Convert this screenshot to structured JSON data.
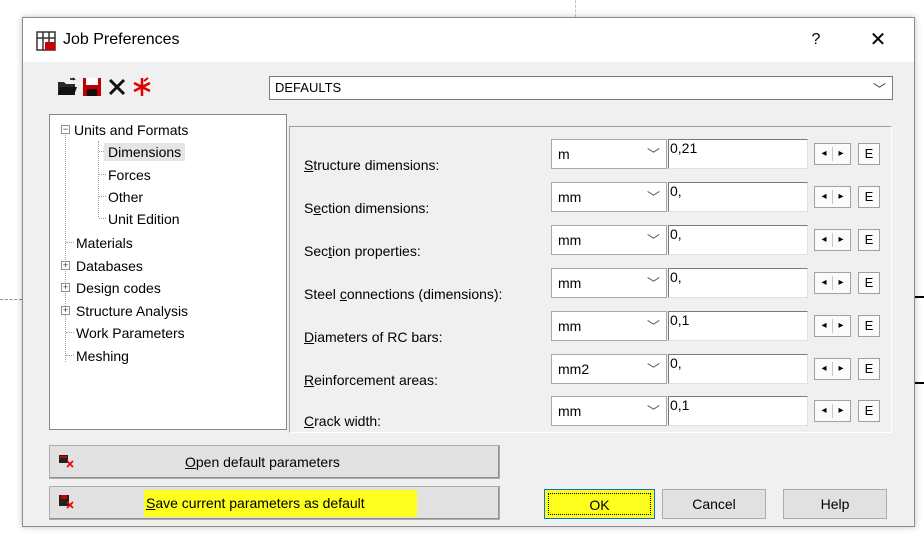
{
  "window": {
    "title": "Job Preferences",
    "help_glyph": "?",
    "close_glyph": "✕"
  },
  "toolbar": {
    "icons": [
      "open-folder-icon",
      "save-disk-icon",
      "delete-x-icon",
      "reset-star-icon"
    ],
    "profile_select": {
      "value": "DEFAULTS"
    }
  },
  "tree": {
    "units_and_formats": "Units and Formats",
    "dimensions": "Dimensions",
    "forces": "Forces",
    "other": "Other",
    "unit_edition": "Unit Edition",
    "materials": "Materials",
    "databases": "Databases",
    "design_codes": "Design codes",
    "structure_analysis": "Structure Analysis",
    "work_parameters": "Work Parameters",
    "meshing": "Meshing",
    "selected": "Dimensions"
  },
  "rows": [
    {
      "label_pre": "",
      "label_u": "S",
      "label_post": "tructure dimensions:",
      "unit": "m",
      "value": "0,21"
    },
    {
      "label_pre": "S",
      "label_u": "e",
      "label_post": "ction dimensions:",
      "unit": "mm",
      "value": "0,"
    },
    {
      "label_pre": "Sec",
      "label_u": "t",
      "label_post": "ion properties:",
      "unit": "mm",
      "value": "0,"
    },
    {
      "label_pre": "Steel ",
      "label_u": "c",
      "label_post": "onnections (dimensions):",
      "unit": "mm",
      "value": "0,"
    },
    {
      "label_pre": "",
      "label_u": "D",
      "label_post": "iameters of RC bars:",
      "unit": "mm",
      "value": "0,1"
    },
    {
      "label_pre": "",
      "label_u": "R",
      "label_post": "einforcement areas:",
      "unit": "mm2",
      "value": "0,"
    },
    {
      "label_pre": "",
      "label_u": "C",
      "label_post": "rack width:",
      "unit": "mm",
      "value": "0,1"
    }
  ],
  "spin": {
    "left": "◂",
    "right": "▸",
    "e": "E"
  },
  "buttons": {
    "open_default": {
      "u": "O",
      "rest": "pen default parameters"
    },
    "save_default": {
      "u": "S",
      "rest": "ave current parameters as default"
    },
    "ok": "OK",
    "cancel": "Cancel",
    "help": "Help"
  },
  "colors": {
    "highlight": "#ffff1f",
    "focus": "#0078d7"
  }
}
